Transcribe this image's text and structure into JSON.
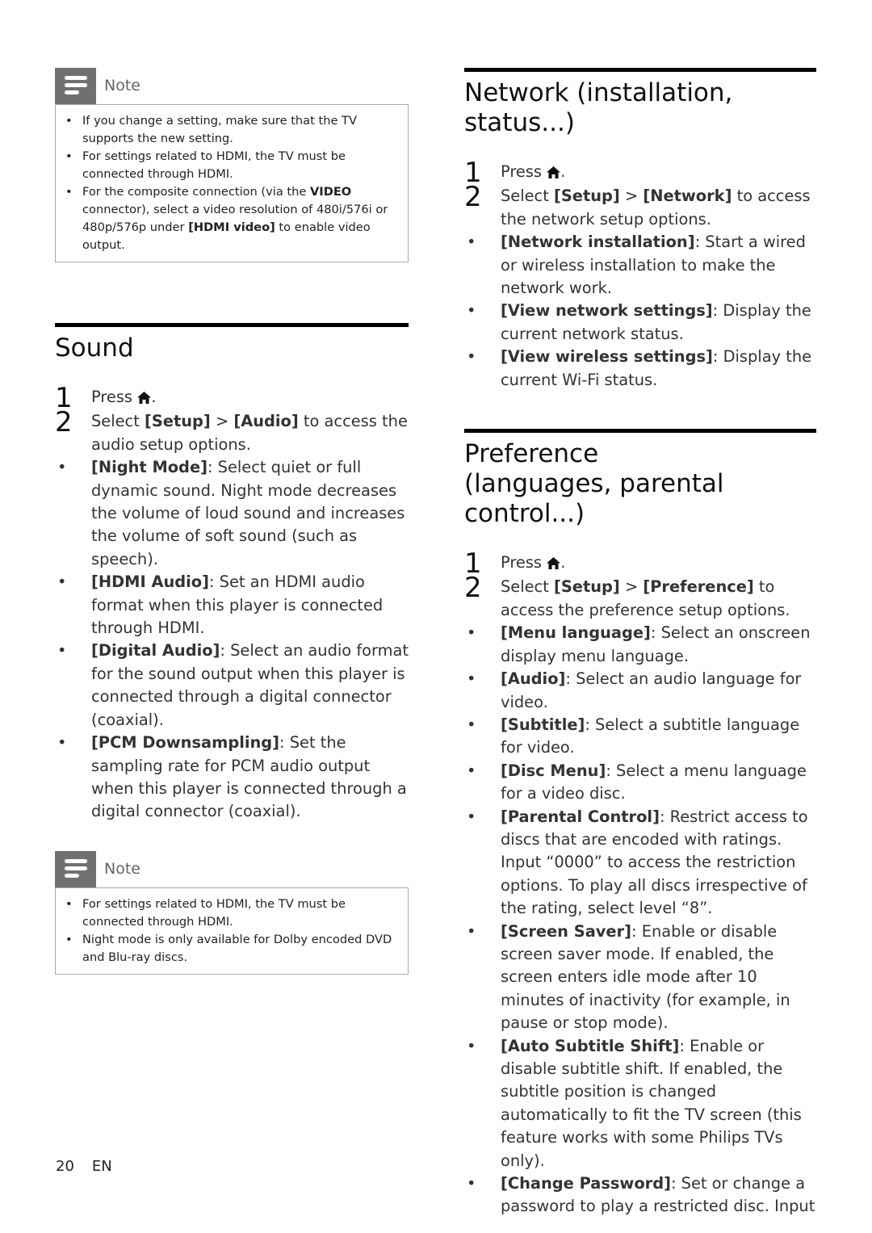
{
  "left": {
    "note1": {
      "title": "Note",
      "items": [
        {
          "parts": [
            {
              "t": "If you change a setting, make sure that the TV supports the new setting."
            }
          ]
        },
        {
          "parts": [
            {
              "t": "For settings related to HDMI, the TV must be connected through HDMI."
            }
          ]
        },
        {
          "parts": [
            {
              "t": "For the composite connection (via the "
            },
            {
              "t": "VIDEO",
              "b": true
            },
            {
              "t": " connector), select a video resolution of 480i/576i or 480p/576p under "
            },
            {
              "t": "[HDMI video]",
              "b": true
            },
            {
              "t": " to enable video output."
            }
          ]
        }
      ]
    },
    "sound": {
      "title": "Sound",
      "steps": [
        {
          "num": "1",
          "parts": [
            {
              "t": "Press "
            },
            {
              "icon": "home"
            },
            {
              "t": "."
            }
          ]
        },
        {
          "num": "2",
          "parts": [
            {
              "t": "Select "
            },
            {
              "t": "[Setup]",
              "b": true
            },
            {
              "t": " > "
            },
            {
              "t": "[Audio]",
              "b": true
            },
            {
              "t": " to access the audio setup options."
            }
          ]
        }
      ],
      "bullets": [
        {
          "term": "[Night Mode]",
          "desc": ": Select quiet or full dynamic sound. Night mode decreases the volume of loud sound and increases the volume of soft sound (such as speech)."
        },
        {
          "term": "[HDMI Audio]",
          "desc": ": Set an HDMI audio format when this player is connected through HDMI."
        },
        {
          "term": "[Digital Audio]",
          "desc": ": Select an audio format for the sound output when this player is connected through a digital connector (coaxial)."
        },
        {
          "term": "[PCM Downsampling]",
          "desc": ": Set the sampling rate for PCM audio output when this player is connected through a digital connector (coaxial)."
        }
      ]
    },
    "note2": {
      "title": "Note",
      "items": [
        {
          "parts": [
            {
              "t": "For settings related to HDMI, the TV must be connected through HDMI."
            }
          ]
        },
        {
          "parts": [
            {
              "t": "Night mode is only available for Dolby encoded DVD and Blu-ray discs."
            }
          ]
        }
      ]
    }
  },
  "right": {
    "network": {
      "title": "Network (installation, status...)",
      "steps": [
        {
          "num": "1",
          "parts": [
            {
              "t": "Press "
            },
            {
              "icon": "home"
            },
            {
              "t": "."
            }
          ]
        },
        {
          "num": "2",
          "parts": [
            {
              "t": "Select "
            },
            {
              "t": "[Setup]",
              "b": true
            },
            {
              "t": " > "
            },
            {
              "t": "[Network]",
              "b": true
            },
            {
              "t": " to access the network setup options."
            }
          ]
        }
      ],
      "bullets": [
        {
          "term": "[Network installation]",
          "desc": ": Start a wired or wireless installation to make the network work."
        },
        {
          "term": "[View network settings]",
          "desc": ": Display the current network status."
        },
        {
          "term": "[View wireless settings]",
          "desc": ": Display the current Wi-Fi status."
        }
      ]
    },
    "preference": {
      "title": "Preference (languages, parental control...)",
      "steps": [
        {
          "num": "1",
          "parts": [
            {
              "t": "Press "
            },
            {
              "icon": "home"
            },
            {
              "t": "."
            }
          ]
        },
        {
          "num": "2",
          "parts": [
            {
              "t": "Select "
            },
            {
              "t": "[Setup]",
              "b": true
            },
            {
              "t": " > "
            },
            {
              "t": "[Preference]",
              "b": true
            },
            {
              "t": " to access the preference setup options."
            }
          ]
        }
      ],
      "bullets": [
        {
          "term": "[Menu language]",
          "desc": ": Select an onscreen display menu language."
        },
        {
          "term": "[Audio]",
          "desc": ": Select an audio language for video."
        },
        {
          "term": "[Subtitle]",
          "desc": ": Select a subtitle language for video."
        },
        {
          "term": "[Disc Menu]",
          "desc": ": Select a menu language for a video disc."
        },
        {
          "term": "[Parental Control]",
          "desc": ": Restrict access to discs that are encoded with ratings. Input “0000” to access the restriction options. To play all discs irrespective of the rating, select level “8”."
        },
        {
          "term": "[Screen Saver]",
          "desc": ": Enable or disable screen saver mode. If enabled, the screen enters idle mode after 10 minutes of inactivity (for example, in pause or stop mode)."
        },
        {
          "term": "[Auto Subtitle Shift]",
          "desc": ": Enable or disable subtitle shift. If enabled, the subtitle position is changed automatically to fit the TV screen (this feature works with some Philips TVs only)."
        },
        {
          "term": "[Change Password]",
          "desc": ": Set or change a password to play a restricted disc. Input"
        }
      ]
    }
  },
  "footer": {
    "page": "20",
    "lang": "EN"
  }
}
